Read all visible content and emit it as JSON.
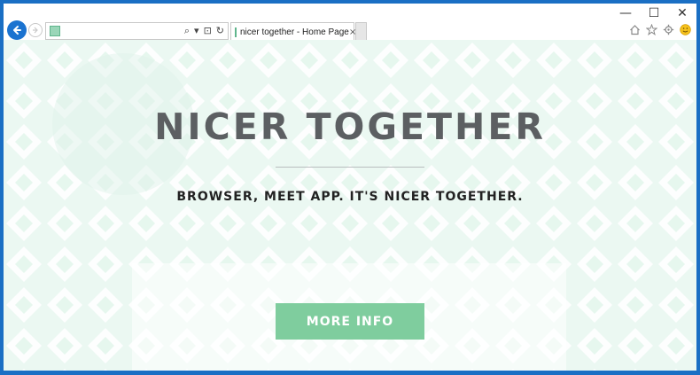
{
  "window": {
    "minimize_icon": "minimize-icon",
    "maximize_icon": "maximize-icon",
    "close_icon": "close-icon",
    "minimize_glyph": "—",
    "maximize_glyph": "☐",
    "close_glyph": "✕"
  },
  "navbar": {
    "address_value": "",
    "address_icons": [
      "search-icon",
      "dropdown-icon",
      "lock-icon",
      "refresh-icon"
    ],
    "address_glyphs": [
      "⌕",
      "▾",
      "⊡",
      "↻"
    ]
  },
  "tab": {
    "title": "nicer together - Home Page",
    "close_glyph": "×"
  },
  "tools": [
    "home-icon",
    "favorites-star-icon",
    "settings-gear-icon",
    "smiley-feedback-icon"
  ],
  "page": {
    "title": "NICER TOGETHER",
    "tagline": "BROWSER, MEET APP. IT'S NICER TOGETHER.",
    "button_label": "MORE INFO"
  },
  "colors": {
    "frame": "#1a6fc4",
    "back_button": "#1b73d0",
    "page_background": "#f1fbf7",
    "title_text": "#5c5f62",
    "button": "#7fcd9e",
    "button_text": "#ffffff"
  }
}
